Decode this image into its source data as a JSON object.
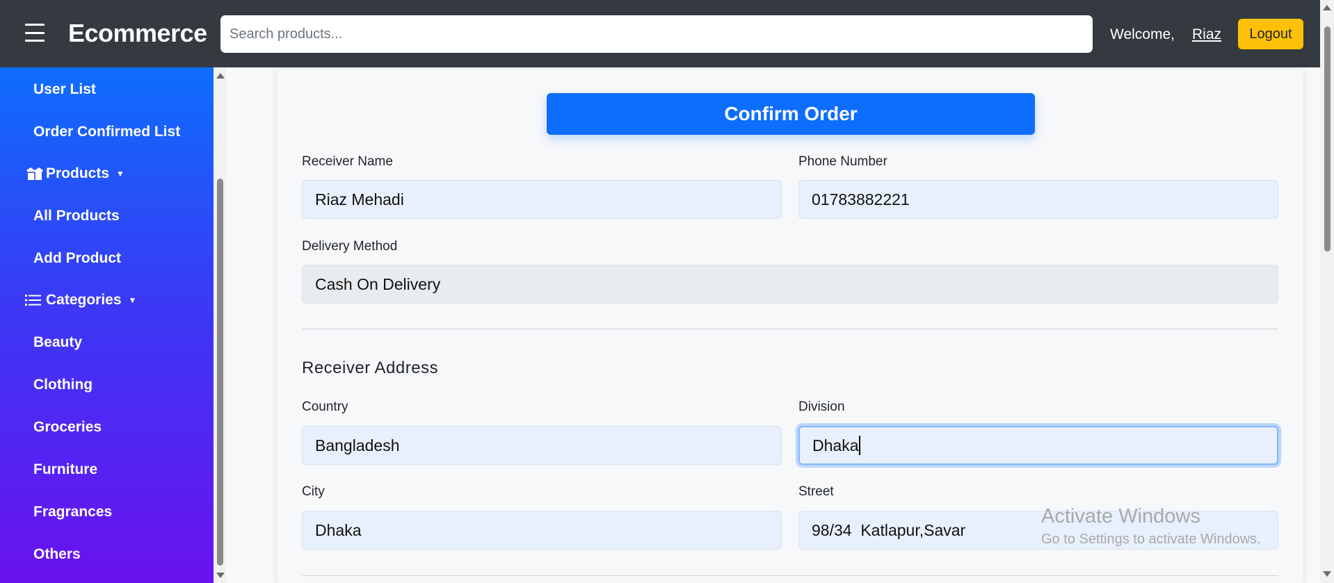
{
  "navbar": {
    "brand": "Ecommerce",
    "search_placeholder": "Search products...",
    "welcome": "Welcome,",
    "username": "Riaz",
    "logout": "Logout",
    "logout_color": "#ffc107",
    "bg_color": "#343a40"
  },
  "sidebar": {
    "gradient_start": "#0d6efd",
    "gradient_end": "#6a11f0",
    "items": [
      {
        "label": "User List",
        "type": "link"
      },
      {
        "label": "Order Confirmed List",
        "type": "link"
      },
      {
        "label": "Products",
        "type": "header",
        "icon": "box-open-icon"
      },
      {
        "label": "All Products",
        "type": "link"
      },
      {
        "label": "Add Product",
        "type": "link"
      },
      {
        "label": "Categories",
        "type": "header",
        "icon": "list-icon"
      },
      {
        "label": "Beauty",
        "type": "link"
      },
      {
        "label": "Clothing",
        "type": "link"
      },
      {
        "label": "Groceries",
        "type": "link"
      },
      {
        "label": "Furniture",
        "type": "link"
      },
      {
        "label": "Fragrances",
        "type": "link"
      },
      {
        "label": "Others",
        "type": "link"
      }
    ]
  },
  "form": {
    "title": "Confirm Order",
    "receiver_name_label": "Receiver Name",
    "receiver_name": "Riaz Mehadi",
    "phone_label": "Phone Number",
    "phone": "01783882221",
    "delivery_label": "Delivery Method",
    "delivery": "Cash On Delivery",
    "address_title": "Receiver Address",
    "country_label": "Country",
    "country": "Bangladesh",
    "division_label": "Division",
    "division": "Dhaka",
    "city_label": "City",
    "city": "Dhaka",
    "street_label": "Street",
    "street": "98/34  Katlapur,Savar"
  },
  "watermark": {
    "line1": "Activate Windows",
    "line2": "Go to Settings to activate Windows."
  }
}
